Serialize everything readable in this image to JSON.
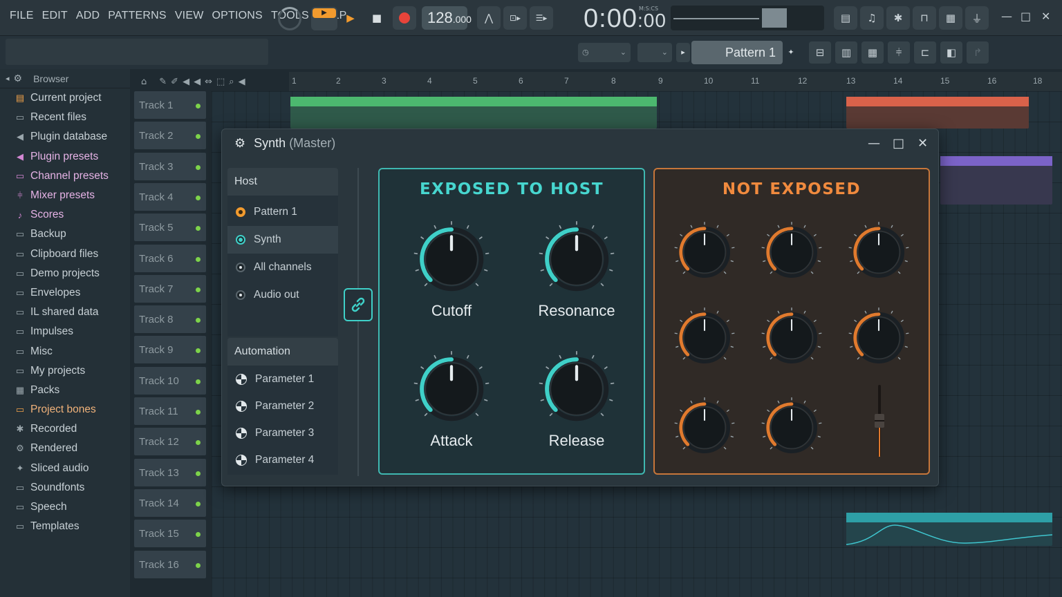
{
  "menu": [
    "FILE",
    "EDIT",
    "ADD",
    "PATTERNS",
    "VIEW",
    "OPTIONS",
    "TOOLS",
    "HELP"
  ],
  "transport": {
    "tempo_int": "128",
    "tempo_dec": ".000",
    "time_main": "0:00",
    "time_sub": ":00",
    "time_label": "M:S:CS"
  },
  "pattern_selector": "Pattern 1",
  "browser": {
    "title": "Browser",
    "items": [
      {
        "label": "Current project",
        "icon": "doc-icon",
        "style": "orange-doc"
      },
      {
        "label": "Recent files",
        "icon": "folder-icon",
        "style": ""
      },
      {
        "label": "Plugin database",
        "icon": "speaker-icon",
        "style": ""
      },
      {
        "label": "Plugin presets",
        "icon": "speaker-icon",
        "style": "pink"
      },
      {
        "label": "Channel presets",
        "icon": "folder-icon",
        "style": "pink"
      },
      {
        "label": "Mixer presets",
        "icon": "mixer-icon",
        "style": "pink"
      },
      {
        "label": "Scores",
        "icon": "note-icon",
        "style": "pink"
      },
      {
        "label": "Backup",
        "icon": "folder-icon",
        "style": ""
      },
      {
        "label": "Clipboard files",
        "icon": "folder-icon",
        "style": ""
      },
      {
        "label": "Demo projects",
        "icon": "folder-icon",
        "style": ""
      },
      {
        "label": "Envelopes",
        "icon": "folder-icon",
        "style": ""
      },
      {
        "label": "IL shared data",
        "icon": "folder-icon",
        "style": ""
      },
      {
        "label": "Impulses",
        "icon": "folder-icon",
        "style": ""
      },
      {
        "label": "Misc",
        "icon": "folder-icon",
        "style": ""
      },
      {
        "label": "My projects",
        "icon": "folder-icon",
        "style": ""
      },
      {
        "label": "Packs",
        "icon": "packs-icon",
        "style": ""
      },
      {
        "label": "Project bones",
        "icon": "folder-icon",
        "style": "orange"
      },
      {
        "label": "Recorded",
        "icon": "recorded-icon",
        "style": ""
      },
      {
        "label": "Rendered",
        "icon": "rendered-icon",
        "style": ""
      },
      {
        "label": "Sliced audio",
        "icon": "sliced-icon",
        "style": ""
      },
      {
        "label": "Soundfonts",
        "icon": "folder-icon",
        "style": ""
      },
      {
        "label": "Speech",
        "icon": "folder-icon",
        "style": ""
      },
      {
        "label": "Templates",
        "icon": "folder-icon",
        "style": ""
      }
    ]
  },
  "tracks": [
    "Track 1",
    "Track 2",
    "Track 3",
    "Track 4",
    "Track 5",
    "Track 6",
    "Track 7",
    "Track 8",
    "Track 9",
    "Track 10",
    "Track 11",
    "Track 12",
    "Track 13",
    "Track 14",
    "Track 15",
    "Track 16"
  ],
  "ruler": [
    "1",
    "2",
    "3",
    "4",
    "5",
    "6",
    "7",
    "8",
    "9",
    "10",
    "11",
    "12",
    "13",
    "14",
    "15",
    "16",
    "18"
  ],
  "plugin": {
    "title": "Synth",
    "subtitle": "(Master)",
    "host_header": "Host",
    "host_options": [
      {
        "label": "Pattern 1",
        "state": "orange"
      },
      {
        "label": "Synth",
        "state": "teal"
      },
      {
        "label": "All channels",
        "state": "dot"
      },
      {
        "label": "Audio out",
        "state": "dot"
      }
    ],
    "automation_header": "Automation",
    "parameters": [
      "Parameter 1",
      "Parameter 2",
      "Parameter 3",
      "Parameter 4"
    ],
    "exposed_title": "EXPOSED TO HOST",
    "not_exposed_title": "NOT EXPOSED",
    "exposed_knobs": [
      "Cutoff",
      "Resonance",
      "Attack",
      "Release"
    ],
    "colors": {
      "exposed": "#3fd0c8",
      "not_exposed": "#e07a2e"
    }
  }
}
